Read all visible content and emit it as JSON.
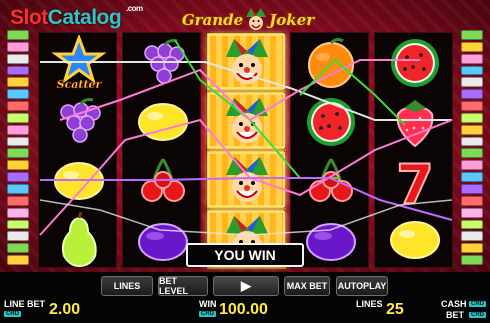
{
  "watermark": {
    "slot": "Slot",
    "catalog": "Catalog",
    "com": ".com"
  },
  "logo": {
    "word1": "Grande",
    "word2": "Joker"
  },
  "reels": {
    "r1": [
      "scatter",
      "grapes",
      "lemon",
      "pear"
    ],
    "r2": [
      "grapes",
      "lemon",
      "cherries",
      "plum"
    ],
    "r3": [
      "joker",
      "joker",
      "joker",
      "joker"
    ],
    "r4": [
      "orange",
      "watermelon",
      "cherries",
      "plum"
    ],
    "r5": [
      "watermelon",
      "strawberry",
      "seven",
      "lemon"
    ]
  },
  "scatter_label": "Scatter",
  "seven_label": "7",
  "win_banner": "YOU WIN",
  "buttons": {
    "lines": "LINES",
    "bet_level": "BET LEVEL",
    "play": "▶",
    "max_bet": "MAX BET",
    "autoplay": "AUTOPLAY"
  },
  "stats": {
    "line_bet_label": "LINE BET",
    "line_bet_value": "2.00",
    "win_label": "WIN",
    "win_value": "100.00",
    "lines_label": "LINES",
    "lines_value": "25",
    "cash_label": "CASH",
    "bet_label": "BET",
    "crd": "CRD"
  },
  "colors": {
    "line_green": "#3ddc3d",
    "line_pink": "#ff7bd6",
    "line_white": "#e6e6e6",
    "line_violet": "#c06bff",
    "value_yellow": "#ffe94a",
    "crd_cyan": "#24c7c5"
  }
}
